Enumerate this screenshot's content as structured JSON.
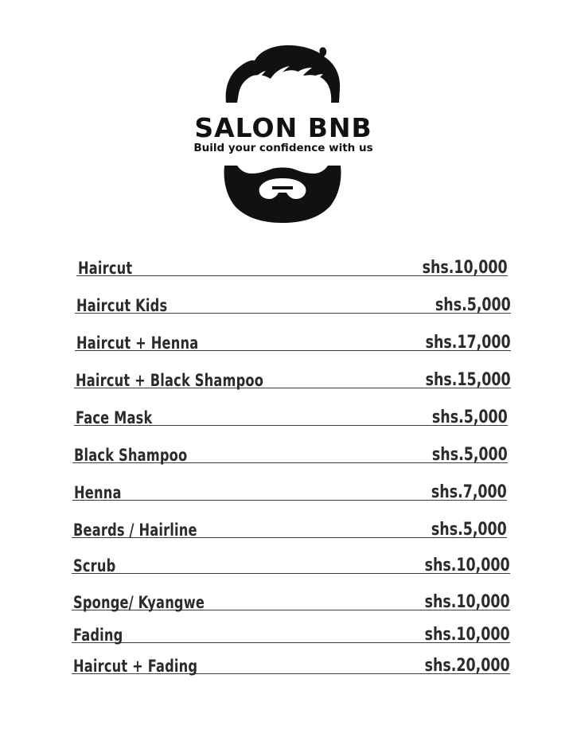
{
  "brand": {
    "name": "SALON BNB",
    "tagline": "Build your confidence with us"
  },
  "services": [
    {
      "name": "Haircut",
      "price": "shs.10,000"
    },
    {
      "name": "Haircut Kids",
      "price": "shs.5,000"
    },
    {
      "name": "Haircut + Henna",
      "price": "shs.17,000"
    },
    {
      "name": "Haircut + Black Shampoo",
      "price": "shs.15,000"
    },
    {
      "name": "Face Mask",
      "price": "shs.5,000"
    },
    {
      "name": "Black Shampoo",
      "price": "shs.5,000"
    },
    {
      "name": "Henna",
      "price": "shs.7,000"
    },
    {
      "name": "Beards / Hairline",
      "price": "shs.5,000"
    },
    {
      "name": "Scrub",
      "price": "shs.10,000"
    },
    {
      "name": "Sponge/ Kyangwe",
      "price": "shs.10,000"
    },
    {
      "name": "Fading",
      "price": "shs.10,000"
    },
    {
      "name": "Haircut + Fading",
      "price": "shs.20,000"
    }
  ],
  "colors": {
    "ink": "#111111",
    "text": "#2b2b2b",
    "background": "#ffffff"
  }
}
